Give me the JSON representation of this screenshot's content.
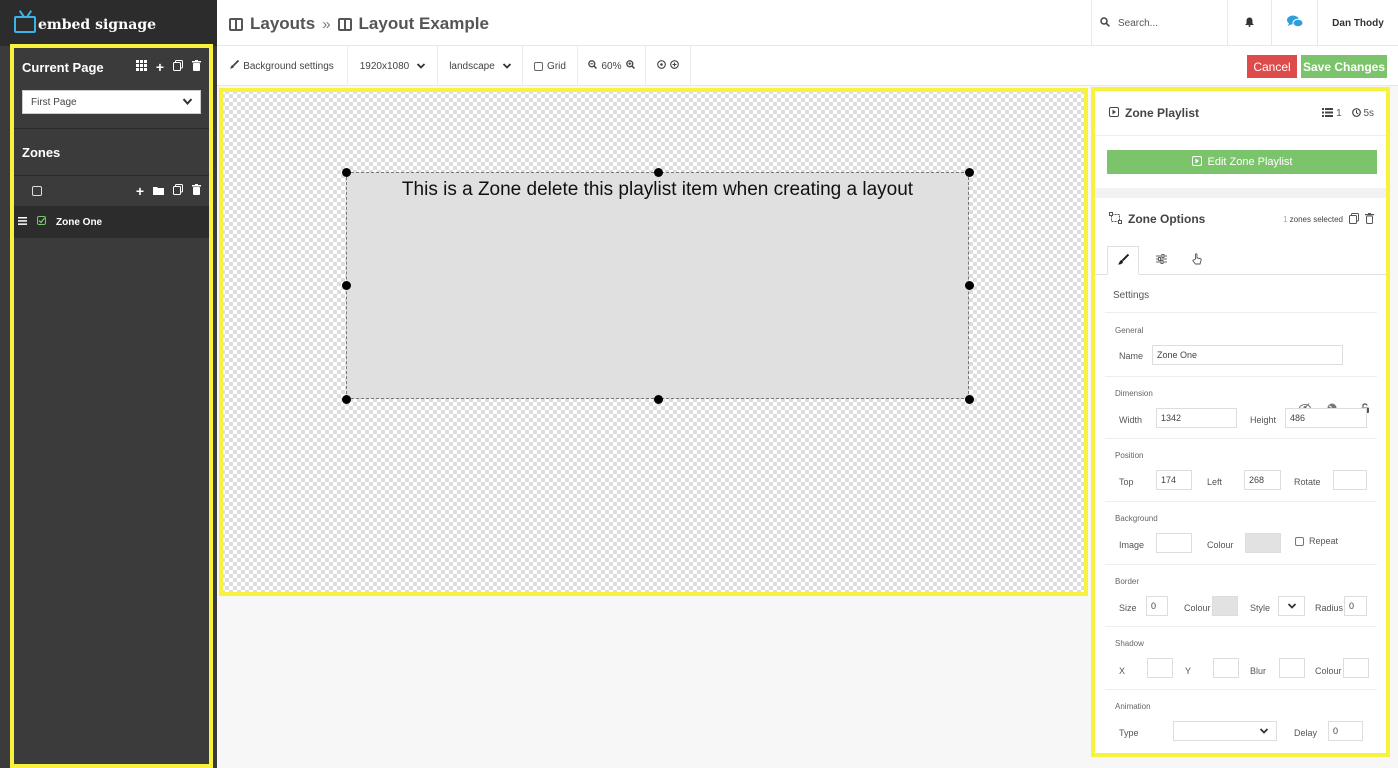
{
  "app": {
    "brand": "embed signage"
  },
  "header": {
    "crumb1": "Layouts",
    "separator": "»",
    "crumb2": "Layout Example",
    "search_placeholder": "Search...",
    "user_name": "Dan Thody"
  },
  "toolbar": {
    "background_settings": "Background settings",
    "resolution": "1920x1080",
    "orientation": "landscape",
    "grid": "Grid",
    "zoom": "60%",
    "cancel": "Cancel",
    "save": "Save Changes"
  },
  "sidebar": {
    "current_page_title": "Current Page",
    "page_select_value": "First Page",
    "zones_title": "Zones",
    "zones": [
      {
        "name": "Zone One",
        "checked": true
      }
    ]
  },
  "canvas": {
    "zone_text": "This is a Zone delete this playlist item when creating a layout"
  },
  "panel": {
    "zone_playlist_title": "Zone Playlist",
    "playlist_count": "1",
    "playlist_duration": "5s",
    "edit_playlist_button": "Edit Zone Playlist",
    "zone_options_title": "Zone Options",
    "zones_selected_count": "1",
    "zones_selected_text": "zones selected",
    "settings_title": "Settings",
    "general": {
      "heading": "General",
      "name_label": "Name",
      "name_value": "Zone One"
    },
    "dimension": {
      "heading": "Dimension",
      "width_label": "Width",
      "width_value": "1342",
      "height_label": "Height",
      "height_value": "486"
    },
    "position": {
      "heading": "Position",
      "top_label": "Top",
      "top_value": "174",
      "left_label": "Left",
      "left_value": "268",
      "rotate_label": "Rotate",
      "rotate_value": ""
    },
    "background": {
      "heading": "Background",
      "image_label": "Image",
      "colour_label": "Colour",
      "repeat_label": "Repeat"
    },
    "border": {
      "heading": "Border",
      "size_label": "Size",
      "size_value": "0",
      "colour_label": "Colour",
      "style_label": "Style",
      "radius_label": "Radius",
      "radius_value": "0"
    },
    "shadow": {
      "heading": "Shadow",
      "x_label": "X",
      "y_label": "Y",
      "blur_label": "Blur",
      "colour_label": "Colour"
    },
    "animation": {
      "heading": "Animation",
      "type_label": "Type",
      "delay_label": "Delay",
      "delay_value": "0"
    }
  },
  "colors": {
    "accent_blue": "#3ab4e6",
    "save_green": "#7cc46b",
    "cancel_red": "#dd4b4b",
    "highlight_yellow": "#f7f33d",
    "sidebar_bg": "#3b3b3b"
  }
}
